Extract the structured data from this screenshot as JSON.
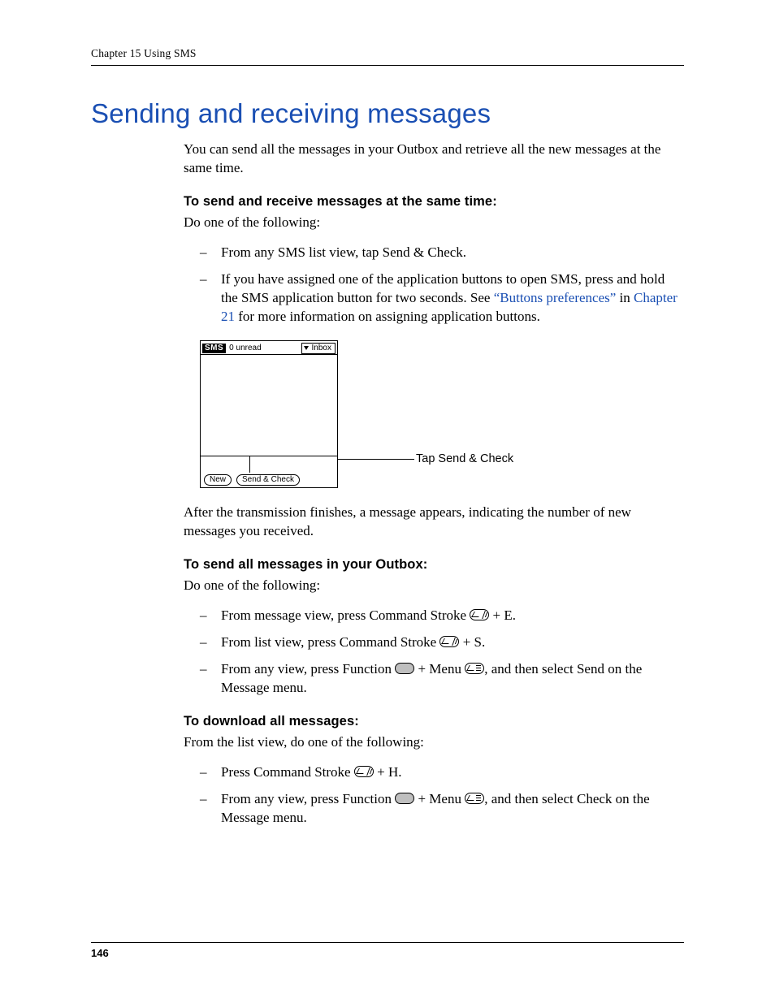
{
  "header": {
    "text": "Chapter 15   Using SMS"
  },
  "title": "Sending and receiving messages",
  "intro": "You can send all the messages in your Outbox and retrieve all the new messages at the same time.",
  "sec1": {
    "head": "To send and receive messages at the same time:",
    "lead": "Do one of the following:",
    "b1": "From any SMS list view, tap Send & Check.",
    "b2_a": "If you have assigned one of the application buttons to open SMS, press and hold the SMS application button for two seconds. See ",
    "b2_link1": "“Buttons preferences”",
    "b2_b": " in ",
    "b2_link2": "Chapter 21",
    "b2_c": " for more information on assigning application buttons."
  },
  "figure": {
    "app": "SMS",
    "unread": "0 unread",
    "dropdown": "Inbox",
    "btn_new": "New",
    "btn_send": "Send & Check",
    "callout": "Tap Send & Check"
  },
  "after_fig": "After the transmission finishes, a message appears, indicating the number of new messages you received.",
  "sec2": {
    "head": "To send all messages in your Outbox:",
    "lead": "Do one of the following:",
    "b1_a": "From message view, press Command Stroke ",
    "b1_b": " + E.",
    "b2_a": "From list view, press Command Stroke ",
    "b2_b": " + S.",
    "b3_a": "From any view, press Function ",
    "b3_b": " + Menu ",
    "b3_c": ", and then select Send on the Message menu."
  },
  "sec3": {
    "head": "To download all messages:",
    "lead": "From the list view, do one of the following:",
    "b1_a": "Press Command Stroke ",
    "b1_b": " + H.",
    "b2_a": "From any view, press Function ",
    "b2_b": " + Menu ",
    "b2_c": ", and then select Check on the Message menu."
  },
  "page_number": "146"
}
